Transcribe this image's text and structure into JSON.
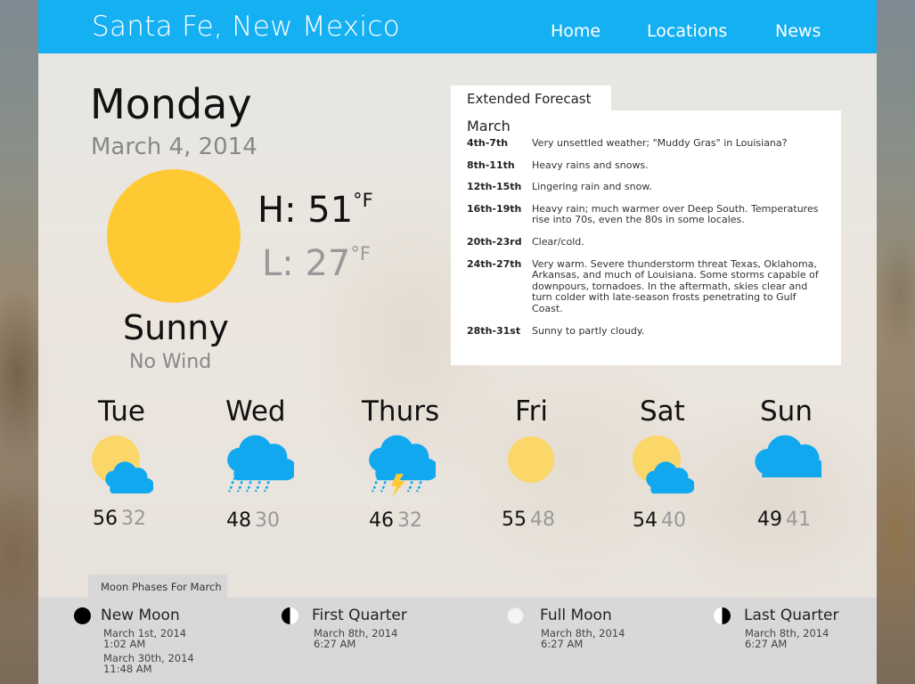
{
  "header": {
    "city": "Santa Fe, New Mexico",
    "nav": [
      "Home",
      "Locations",
      "News"
    ],
    "bar_color": "#15b0f2"
  },
  "today": {
    "day": "Monday",
    "date": "March 4, 2014",
    "high_label": "H: 51",
    "low_label": "L: 27",
    "unit": "°F",
    "condition": "Sunny",
    "wind": "No Wind",
    "icon": "sun-icon",
    "sun_color": "#ffc934"
  },
  "extended": {
    "title": "Extended Forecast",
    "month": "March",
    "rows": [
      {
        "range": "4th-7th",
        "desc": "Very unsettled weather; \"Muddy Gras\" in Louisiana?"
      },
      {
        "range": "8th-11th",
        "desc": "Heavy rains and snows."
      },
      {
        "range": "12th-15th",
        "desc": "Lingering rain and snow."
      },
      {
        "range": "16th-19th",
        "desc": "Heavy rain; much warmer over Deep South. Temperatures rise into 70s, even the 80s in some locales."
      },
      {
        "range": "20th-23rd",
        "desc": "Clear/cold."
      },
      {
        "range": "24th-27th",
        "desc": "Very warm. Severe thunderstorm threat Texas, Oklahoma, Arkansas, and much of Louisiana. Some storms capable of downpours, tornadoes. In the aftermath, skies clear and turn colder with late-season frosts penetrating to Gulf Coast."
      },
      {
        "range": "28th-31st",
        "desc": "Sunny to partly cloudy."
      }
    ]
  },
  "forecast": [
    {
      "day": "Tue",
      "hi": "56",
      "lo": "32",
      "icon": "partly-cloudy-icon"
    },
    {
      "day": "Wed",
      "hi": "48",
      "lo": "30",
      "icon": "rain-cloud-icon"
    },
    {
      "day": "Thurs",
      "hi": "46",
      "lo": "32",
      "icon": "thunderstorm-icon"
    },
    {
      "day": "Fri",
      "hi": "55",
      "lo": "48",
      "icon": "sun-icon"
    },
    {
      "day": "Sat",
      "hi": "54",
      "lo": "40",
      "icon": "partly-cloudy-icon"
    },
    {
      "day": "Sun",
      "hi": "49",
      "lo": "41",
      "icon": "cloud-icon"
    }
  ],
  "moon": {
    "title": "Moon Phases For March",
    "phases": [
      {
        "name": "New Moon",
        "icon": "new-moon-icon",
        "dates": [
          "March 1st, 2014",
          "1:02 AM",
          "March 30th, 2014",
          "11:48 AM"
        ]
      },
      {
        "name": "First Quarter",
        "icon": "first-quarter-moon-icon",
        "dates": [
          "March 8th, 2014",
          "6:27 AM"
        ]
      },
      {
        "name": "Full Moon",
        "icon": "full-moon-icon",
        "dates": [
          "March 8th, 2014",
          "6:27 AM"
        ]
      },
      {
        "name": "Last Quarter",
        "icon": "last-quarter-moon-icon",
        "dates": [
          "March 8th, 2014",
          "6:27 AM"
        ]
      }
    ]
  },
  "colors": {
    "cloud": "#12a8f0",
    "sun_light": "#fbd668",
    "bolt": "#ffc934",
    "rain": "#12a8f0"
  }
}
